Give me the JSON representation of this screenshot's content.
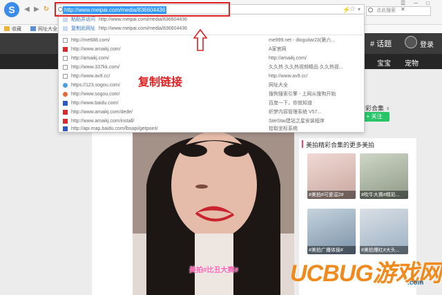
{
  "browser": {
    "logo_glyph": "S",
    "url": "http://www.meipai.com/media/836604436",
    "search_placeholder": "点此搜索",
    "bookmarks": [
      "收藏",
      "网址大全"
    ]
  },
  "dropdown": {
    "suggestions": [
      {
        "label": "粘贴并访问",
        "url": "http://www.meipai.com/media/836604436"
      },
      {
        "label": "复制此网址",
        "url": "http://www.meipai.com/media/836604436"
      }
    ],
    "history": [
      {
        "url": "http://me688.com/",
        "title": "me999.net - dioguitar23(第六...",
        "icon": "page"
      },
      {
        "url": "http://www.amaikj.com/",
        "title": "A家官网",
        "icon": "a-red"
      },
      {
        "url": "http://amaikj.com/",
        "title": "http://amaikj.com/",
        "icon": "page"
      },
      {
        "url": "http://www.337kk.com/",
        "title": "久久热 久久热视频精品 久久热视...",
        "icon": "page"
      },
      {
        "url": "http://www.av9.cc/",
        "title": "http://www.av9.cc/",
        "icon": "page"
      },
      {
        "url": "https://123.sogou.com/",
        "title": "网址大全",
        "icon": "globe"
      },
      {
        "url": "http://www.sogou.com/",
        "title": "搜狗搜索引擎 - 上网从搜狗开始",
        "icon": "sogou"
      },
      {
        "url": "http://www.baidu.com/",
        "title": "百度一下，你就知道",
        "icon": "paw"
      },
      {
        "url": "http://www.amaikj.com/dede/",
        "title": "织梦内容管理系统 V57...",
        "icon": "a-red"
      },
      {
        "url": "http://www.amaikj.com/install/",
        "title": "SiteStar建站之星安装程序",
        "icon": "a-red"
      },
      {
        "url": "http://api.map.baidu.com/lbsapi/getpoint/",
        "title": "拾取坐标系统",
        "icon": "paw"
      }
    ]
  },
  "annotation": {
    "text": "复制链接"
  },
  "site": {
    "nav_right": [
      "# 话题",
      "登录"
    ],
    "nav_links": [
      "宝宝",
      "宠物"
    ],
    "collection_title": "精彩合集 ♀",
    "follow_label": "+ 关注",
    "more_title": "美拍精彩合集的更多美拍",
    "video_caption": "美拍#比丑大赛#",
    "thumbs": [
      {
        "caption": "#美拍#可爱逗2#"
      },
      {
        "caption": "#吹牛大赛#精彩..."
      },
      {
        "caption": "#美拍广播体操#"
      },
      {
        "caption": "#美拍爆红#大头..."
      }
    ]
  },
  "watermark": {
    "text": "UCBUG游戏网",
    "sub": ".com"
  },
  "colors": {
    "highlight_border": "#e02020",
    "selection": "#3399ff",
    "site_dark": "#3b3b3b",
    "follow_green": "#27c468"
  }
}
